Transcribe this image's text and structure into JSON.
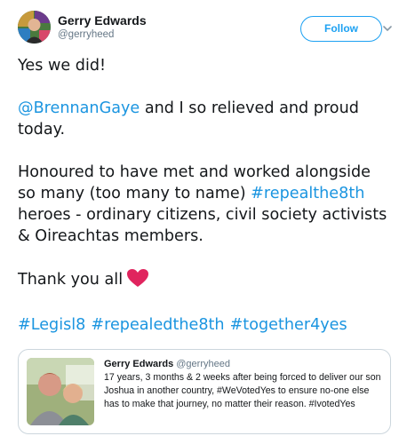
{
  "tweet": {
    "author": {
      "display_name": "Gerry Edwards",
      "handle": "@gerryheed"
    },
    "follow_label": "Follow",
    "paragraphs": {
      "p1": "Yes we did!",
      "p2_mention": "@BrennanGaye",
      "p2_text": " and I so relieved and proud today.",
      "p3_text": "Honoured to have met and worked alongside so many (too many to name) ",
      "p3_hashtag": "#repealthe8th",
      "p3_text_end": " heroes - ordinary citizens, civil society activists & Oireachtas members.",
      "p4_text": "Thank you all"
    },
    "hashtags": [
      "#Legisl8",
      "#repealedthe8th",
      "#together4yes"
    ],
    "heart_color": "#e0245e",
    "link_color": "#1b95e0"
  },
  "quoted_tweet": {
    "display_name": "Gerry Edwards",
    "handle": "@gerryheed",
    "text": "17 years, 3 months & 2 weeks after being forced to deliver our son Joshua in another country, #WeVotedYes to ensure no-one else has to make that journey, no matter their reason. #IvotedYes"
  },
  "icons": {
    "menu": "chevron-down-icon",
    "emoji": "red-heart-icon"
  }
}
